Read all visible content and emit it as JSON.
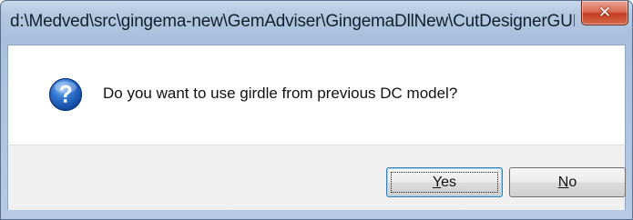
{
  "window": {
    "title": "d:\\Medved\\src\\gingema-new\\GemAdviser\\GingemaDllNew\\CutDesignerGUI\\Tes...",
    "close_symbol": "✕"
  },
  "dialog": {
    "icon": "question-icon",
    "message": "Do you want to use girdle from previous DC model?"
  },
  "buttons": {
    "yes": {
      "mnemonic": "Y",
      "rest": "es"
    },
    "no": {
      "mnemonic": "N",
      "rest": "o"
    }
  },
  "colors": {
    "title_bar": "#b4c8e0",
    "close_button": "#c43d20",
    "content_bg": "#ffffff",
    "footer_bg": "#f0f0f0",
    "icon_blue": "#1f5fb8"
  }
}
